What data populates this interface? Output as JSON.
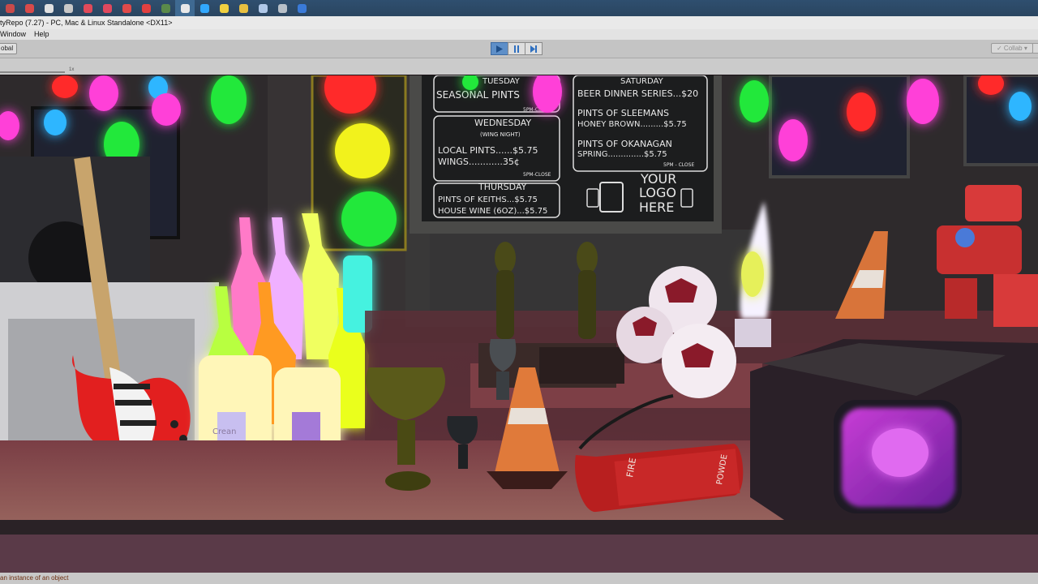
{
  "taskbar": {
    "icons": [
      {
        "name": "start-icon",
        "color": "#c84a4a"
      },
      {
        "name": "chrome-icon",
        "color": "#d84a4a"
      },
      {
        "name": "app-icon",
        "color": "#e0e0e0"
      },
      {
        "name": "app-icon",
        "color": "#c8c8c8"
      },
      {
        "name": "app-icon",
        "color": "#e04a5a"
      },
      {
        "name": "app-icon",
        "color": "#e0485e"
      },
      {
        "name": "app-icon",
        "color": "#e04a4a"
      },
      {
        "name": "app-icon",
        "color": "#e04040"
      },
      {
        "name": "app-icon",
        "color": "#5a8a4a"
      },
      {
        "name": "unity-icon",
        "color": "#e8e8e8"
      },
      {
        "name": "photoshop-icon",
        "color": "#31a8ff"
      },
      {
        "name": "python-icon",
        "color": "#f0d040"
      },
      {
        "name": "app-icon",
        "color": "#e8c040"
      },
      {
        "name": "app-icon",
        "color": "#b0c8e8"
      },
      {
        "name": "app-icon",
        "color": "#b8c0c8"
      },
      {
        "name": "app-icon",
        "color": "#3a7ad8"
      }
    ]
  },
  "window": {
    "title": "ityRepo (7.27) - PC, Mac & Linux Standalone <DX11>"
  },
  "menu": {
    "items": [
      "Window",
      "Help"
    ]
  },
  "toolbar": {
    "global_label": "obal",
    "collab_label": "✓ Collab ▾",
    "play_tooltip": "Play",
    "pause_tooltip": "Pause",
    "step_tooltip": "Step"
  },
  "gameview": {
    "scale_label": "1x",
    "chalkboard_left": {
      "lines": [
        "TUESDAY",
        "SEASONAL PINTS",
        "5PM-CLOSE",
        "WEDNESDAY",
        "(WING NIGHT)",
        "LOCAL PINTS......$5.75",
        "WINGS............35¢",
        "5PM-CLOSE",
        "THURSDAY",
        "PINTS OF KEITHS...$5.75",
        "HOUSE WINE (6OZ)...$5.75"
      ]
    },
    "chalkboard_right": {
      "lines": [
        "SATURDAY",
        "BEER DINNER SERIES...$20",
        "PINTS OF SLEEMANS",
        "HONEY BROWN.........$5.75",
        "PINTS OF OKANAGAN",
        "SPRING..............$5.75",
        "5PM - CLOSE",
        "YOUR",
        "LOGO",
        "HERE"
      ]
    },
    "bottle_label": "Crean",
    "extinguisher_label": "FIRE",
    "extinguisher_label2": "POWDE"
  },
  "status": {
    "message": "an instance of an object"
  },
  "colors": {
    "play_active": "#5e8fc8",
    "neon_red": "#ff2a2a",
    "neon_yellow": "#f2f21a",
    "neon_green": "#22e83a",
    "neon_pink": "#ff3fd8"
  }
}
